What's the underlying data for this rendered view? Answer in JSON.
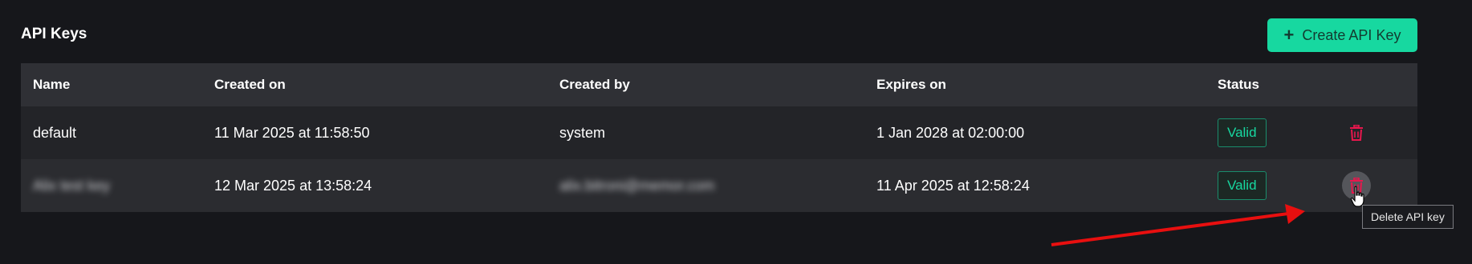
{
  "page": {
    "title": "API Keys",
    "create_button_label": "Create API Key"
  },
  "table": {
    "headers": {
      "name": "Name",
      "created_on": "Created on",
      "created_by": "Created by",
      "expires_on": "Expires on",
      "status": "Status"
    },
    "rows": [
      {
        "name": "default",
        "created_on": "11 Mar 2025 at 11:58:50",
        "created_by": "system",
        "expires_on": "1 Jan 2028 at 02:00:00",
        "status": "Valid"
      },
      {
        "name": "Alix test key",
        "created_on": "12 Mar 2025 at 13:58:24",
        "created_by": "alix.bitroni@memor.com",
        "expires_on": "11 Apr 2025 at 12:58:24",
        "status": "Valid"
      }
    ]
  },
  "tooltip": {
    "text": "Delete API key"
  },
  "colors": {
    "accent": "#17d8a0",
    "delete": "#e8174d",
    "annotation_arrow": "#e80f0f"
  }
}
